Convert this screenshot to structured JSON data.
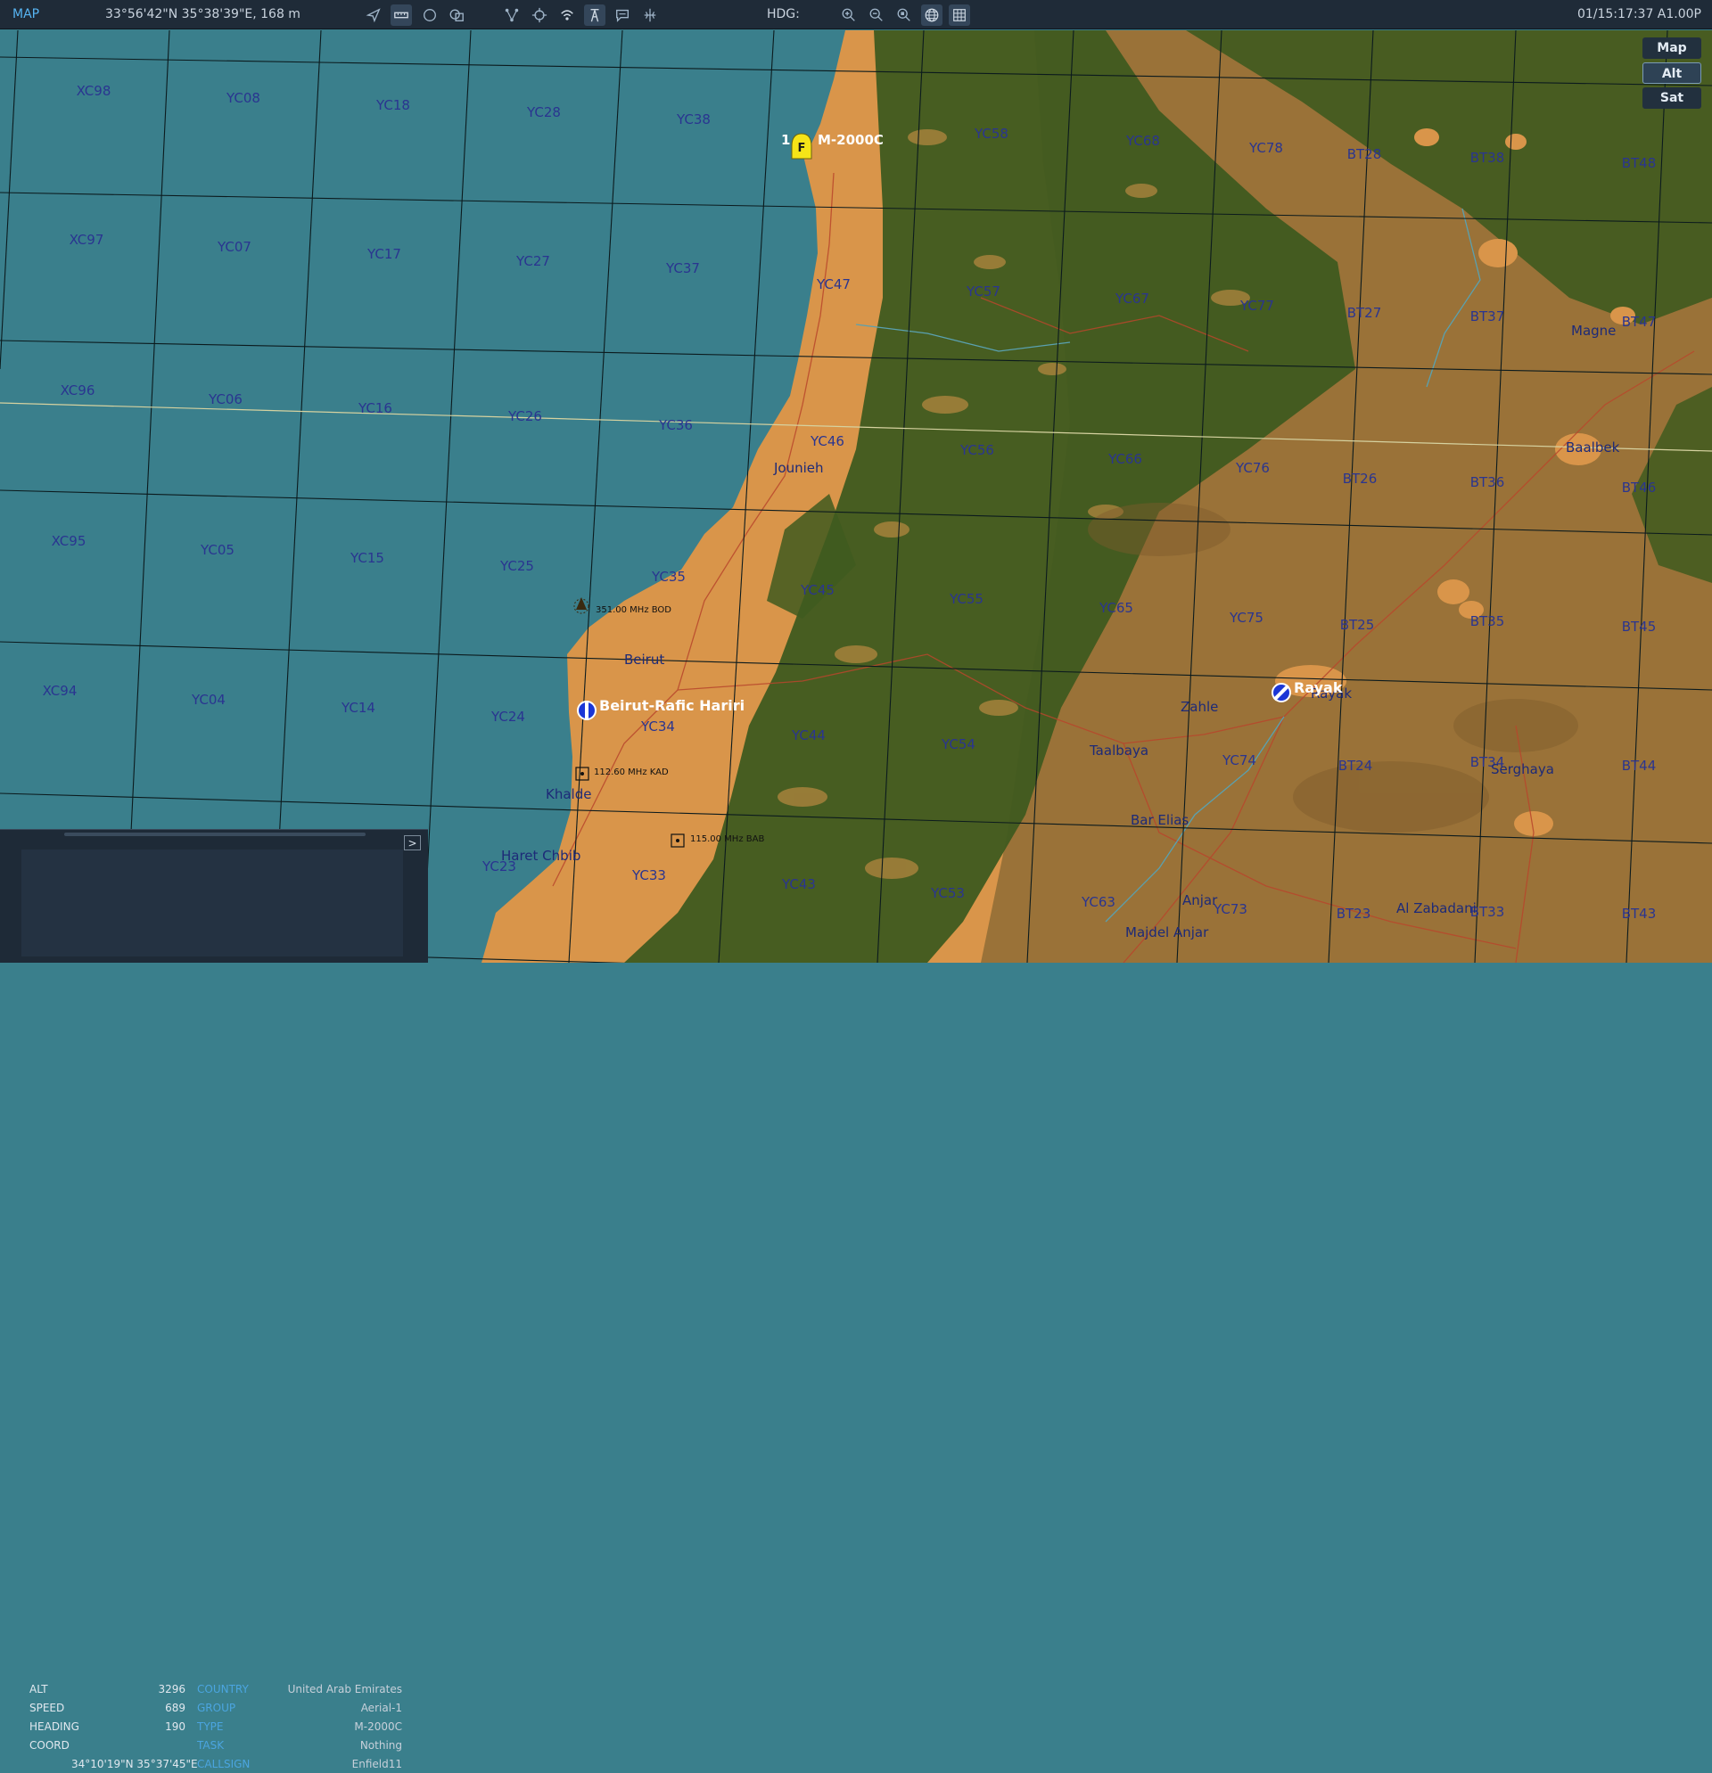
{
  "topbar": {
    "title": "MAP",
    "cursor_coord": "33°56'42\"N 35°38'39\"E, 168 m",
    "hdg_label": "HDG:",
    "time": "01/15:17:37 A1.00P",
    "icons": [
      "navigate-icon",
      "ruler-icon",
      "circle-icon",
      "layers-icon",
      "route-icon",
      "crosshair-icon",
      "signal-icon",
      "tower-icon",
      "chat-icon",
      "network-icon",
      "zoom-in-icon",
      "zoom-out-icon",
      "zoom-fit-icon",
      "globe-icon",
      "grid-icon"
    ]
  },
  "map_toggles": [
    {
      "label": "Map",
      "active": false
    },
    {
      "label": "Alt",
      "active": true
    },
    {
      "label": "Sat",
      "active": false
    }
  ],
  "unit": {
    "number": "1",
    "marker": "F",
    "type": "M-2000C"
  },
  "airfields": [
    {
      "name": "Beirut-Rafic Hariri"
    },
    {
      "name": "Rayak"
    }
  ],
  "navaids": [
    {
      "label": "351.00 MHz BOD"
    },
    {
      "label": "112.60 MHz KAD"
    },
    {
      "label": "115.00 MHz BAB"
    }
  ],
  "grid_labels": [
    "XC98",
    "YC08",
    "YC18",
    "YC28",
    "YC38",
    "YC58",
    "YC68",
    "YC78",
    "BT28",
    "BT38",
    "BT48",
    "XC97",
    "YC07",
    "YC17",
    "YC27",
    "YC37",
    "YC47",
    "YC57",
    "YC67",
    "YC77",
    "BT27",
    "BT37",
    "BT47",
    "XC96",
    "YC06",
    "YC16",
    "YC26",
    "YC36",
    "YC46",
    "YC56",
    "YC66",
    "YC76",
    "BT26",
    "BT36",
    "BT46",
    "XC95",
    "YC05",
    "YC15",
    "YC25",
    "YC35",
    "YC45",
    "YC55",
    "YC65",
    "YC75",
    "BT25",
    "BT35",
    "BT45",
    "XC94",
    "YC04",
    "YC14",
    "YC24",
    "YC34",
    "YC44",
    "YC54",
    "YC74",
    "BT24",
    "BT34",
    "BT44",
    "YC23",
    "YC33",
    "YC43",
    "YC53",
    "YC63",
    "YC73",
    "BT23",
    "BT33",
    "BT43"
  ],
  "places": [
    "Jounieh",
    "Beirut",
    "Khalde",
    "Haret Chbib",
    "Zahle",
    "Taalbaya",
    "Bar Elias",
    "Anjar",
    "Majdel Anjar",
    "Al Zabadani",
    "Serghaya",
    "Baalbek",
    "Magne",
    "Rayak"
  ],
  "info": {
    "expand_label": ">",
    "rows": [
      {
        "k1": "ALT",
        "v1": "3296",
        "k2": "COUNTRY",
        "v2": "United Arab Emirates"
      },
      {
        "k1": "SPEED",
        "v1": "689",
        "k2": "GROUP",
        "v2": "Aerial-1"
      },
      {
        "k1": "HEADING",
        "v1": "190",
        "k2": "TYPE",
        "v2": "M-2000C"
      },
      {
        "k1": "COORD",
        "v1": "",
        "k2": "TASK",
        "v2": "Nothing"
      },
      {
        "k1": "",
        "v1": "34°10'19\"N 35°37'45\"E",
        "k2": "CALLSIGN",
        "v2": "Enfield11"
      }
    ]
  },
  "colors": {
    "sea": "#3a7f8c",
    "lowland": "#d9954a",
    "forest": "#3f5a1f",
    "highland": "#9a7238",
    "grid_label": "#2a3590",
    "unit_marker": "#f5e418",
    "toolbar_bg": "#1f2b38",
    "accent": "#4ba5e0"
  }
}
